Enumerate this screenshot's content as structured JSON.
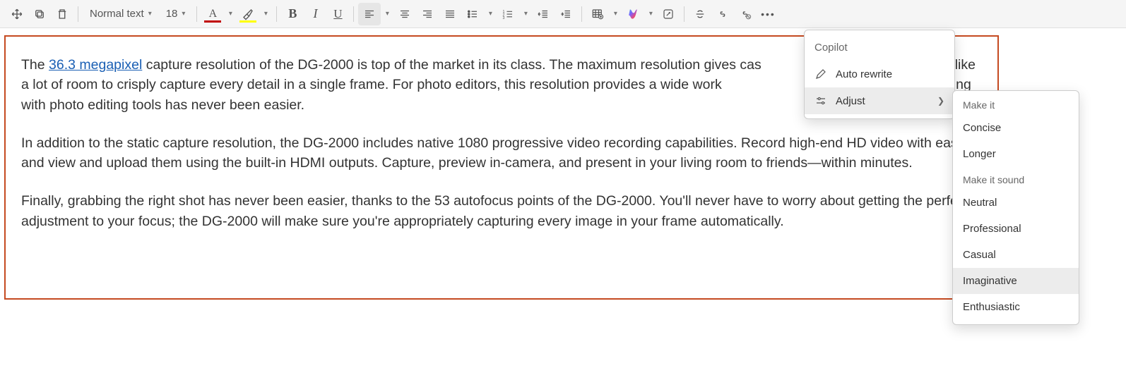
{
  "toolbar": {
    "style_select": "Normal text",
    "font_size": "18"
  },
  "copilot_menu": {
    "title": "Copilot",
    "auto_rewrite": "Auto rewrite",
    "adjust": "Adjust"
  },
  "adjust_menu": {
    "header1": "Make it",
    "concise": "Concise",
    "longer": "Longer",
    "header2": "Make it sound",
    "neutral": "Neutral",
    "professional": "Professional",
    "casual": "Casual",
    "imaginative": "Imaginative",
    "enthusiastic": "Enthusiastic"
  },
  "doc": {
    "p1_a": "The ",
    "p1_link": "36.3 megapixel",
    "p1_b": " capture resolution of the DG-2000 is top of the market in its class. The maximum resolution gives cas",
    "p1_c": "l pros alike a lot of room to crisply capture every detail in a single frame. For photo editors, this resolution provides a wide work",
    "p1_d": "ing, and painting with photo editing tools has never been easier.",
    "p2": "In addition to the static capture resolution, the DG-2000 includes native 1080 progressive video recording capabilities. Record high-end HD video with ease, and view and upload them using the built-in HDMI outputs. Capture, preview in-camera, and present in your living room to friends—within minutes.",
    "p3": "Finally, grabbing the right shot has never been easier, thanks to the 53 autofocus points of the DG-2000. You'll never have to worry about getting the perfect adjustment to your focus; the DG-2000 will make sure you're appropriately capturing every image in your frame automatically."
  }
}
